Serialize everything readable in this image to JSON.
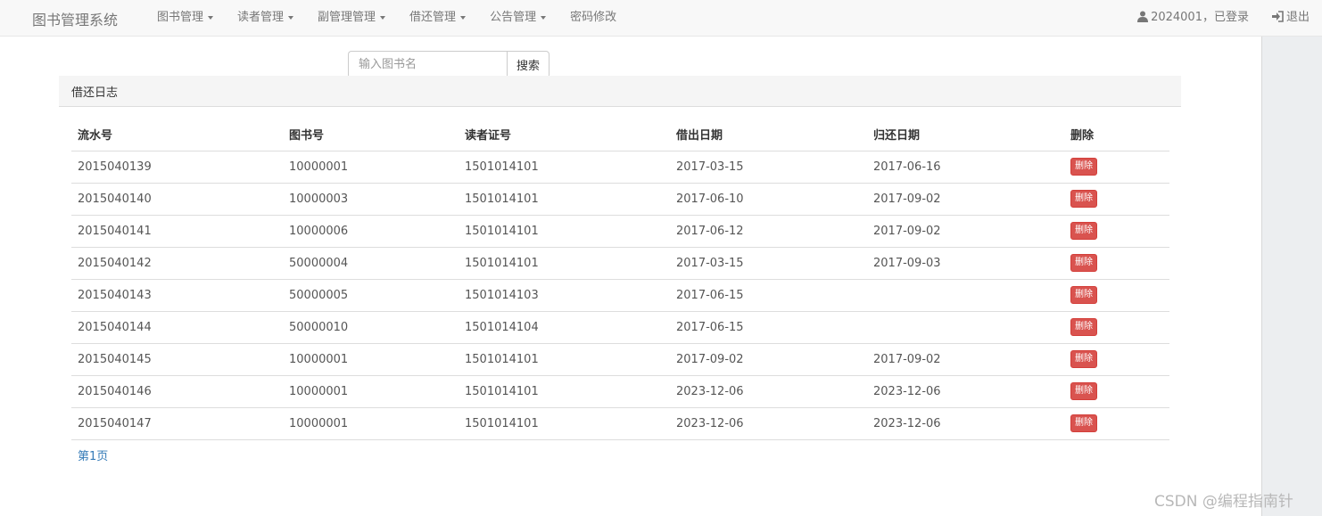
{
  "navbar": {
    "brand": "图书管理系统",
    "menus": [
      {
        "label": "图书管理"
      },
      {
        "label": "读者管理"
      },
      {
        "label": "副管理管理"
      },
      {
        "label": "借还管理"
      },
      {
        "label": "公告管理"
      },
      {
        "label": "密码修改"
      }
    ],
    "user_label": "2024001，已登录",
    "logout_label": "退出"
  },
  "search": {
    "placeholder": "输入图书名",
    "button_label": "搜索"
  },
  "panel": {
    "title": "借还日志"
  },
  "table": {
    "headers": [
      "流水号",
      "图书号",
      "读者证号",
      "借出日期",
      "归还日期",
      "删除"
    ],
    "delete_label": "删除",
    "rows": [
      {
        "serial": "2015040139",
        "book_id": "10000001",
        "reader_id": "1501014101",
        "lend_date": "2017-03-15",
        "return_date": "2017-06-16"
      },
      {
        "serial": "2015040140",
        "book_id": "10000003",
        "reader_id": "1501014101",
        "lend_date": "2017-06-10",
        "return_date": "2017-09-02"
      },
      {
        "serial": "2015040141",
        "book_id": "10000006",
        "reader_id": "1501014101",
        "lend_date": "2017-06-12",
        "return_date": "2017-09-02"
      },
      {
        "serial": "2015040142",
        "book_id": "50000004",
        "reader_id": "1501014101",
        "lend_date": "2017-03-15",
        "return_date": "2017-09-03"
      },
      {
        "serial": "2015040143",
        "book_id": "50000005",
        "reader_id": "1501014103",
        "lend_date": "2017-06-15",
        "return_date": ""
      },
      {
        "serial": "2015040144",
        "book_id": "50000010",
        "reader_id": "1501014104",
        "lend_date": "2017-06-15",
        "return_date": ""
      },
      {
        "serial": "2015040145",
        "book_id": "10000001",
        "reader_id": "1501014101",
        "lend_date": "2017-09-02",
        "return_date": "2017-09-02"
      },
      {
        "serial": "2015040146",
        "book_id": "10000001",
        "reader_id": "1501014101",
        "lend_date": "2023-12-06",
        "return_date": "2023-12-06"
      },
      {
        "serial": "2015040147",
        "book_id": "10000001",
        "reader_id": "1501014101",
        "lend_date": "2023-12-06",
        "return_date": "2023-12-06"
      }
    ]
  },
  "pagination": {
    "label": "第1页"
  },
  "watermark": "CSDN @编程指南针",
  "colors": {
    "danger": "#d9534f",
    "link": "#337ab7",
    "navbar_bg": "#f8f8f8"
  },
  "icons": {
    "user": "user-icon",
    "logout": "logout-icon"
  }
}
